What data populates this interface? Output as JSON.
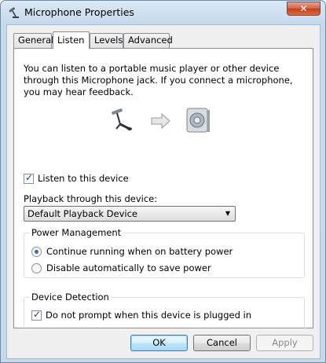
{
  "window": {
    "title": "Microphone Properties",
    "close_glyph": "✕"
  },
  "tabs": [
    {
      "label": "General"
    },
    {
      "label": "Listen"
    },
    {
      "label": "Levels"
    },
    {
      "label": "Advanced"
    }
  ],
  "listen": {
    "description": "You can listen to a portable music player or other device through this Microphone jack.  If you connect a microphone, you may hear feedback.",
    "listen_checkbox": {
      "label": "Listen to this device",
      "checked": true
    },
    "playback_label": "Playback through this device:",
    "playback_device": "Default Playback Device",
    "power_management": {
      "title": "Power Management",
      "options": [
        {
          "label": "Continue running when on battery power",
          "selected": true
        },
        {
          "label": "Disable automatically to save power",
          "selected": false
        }
      ]
    },
    "device_detection": {
      "title": "Device Detection",
      "checkbox": {
        "label": "Do not prompt when this device is plugged in",
        "checked": true
      }
    }
  },
  "buttons": {
    "ok": "OK",
    "cancel": "Cancel",
    "apply": "Apply"
  },
  "icons": {
    "microphone": "microphone-icon",
    "arrow": "arrow-right-icon",
    "speaker": "speaker-icon"
  }
}
